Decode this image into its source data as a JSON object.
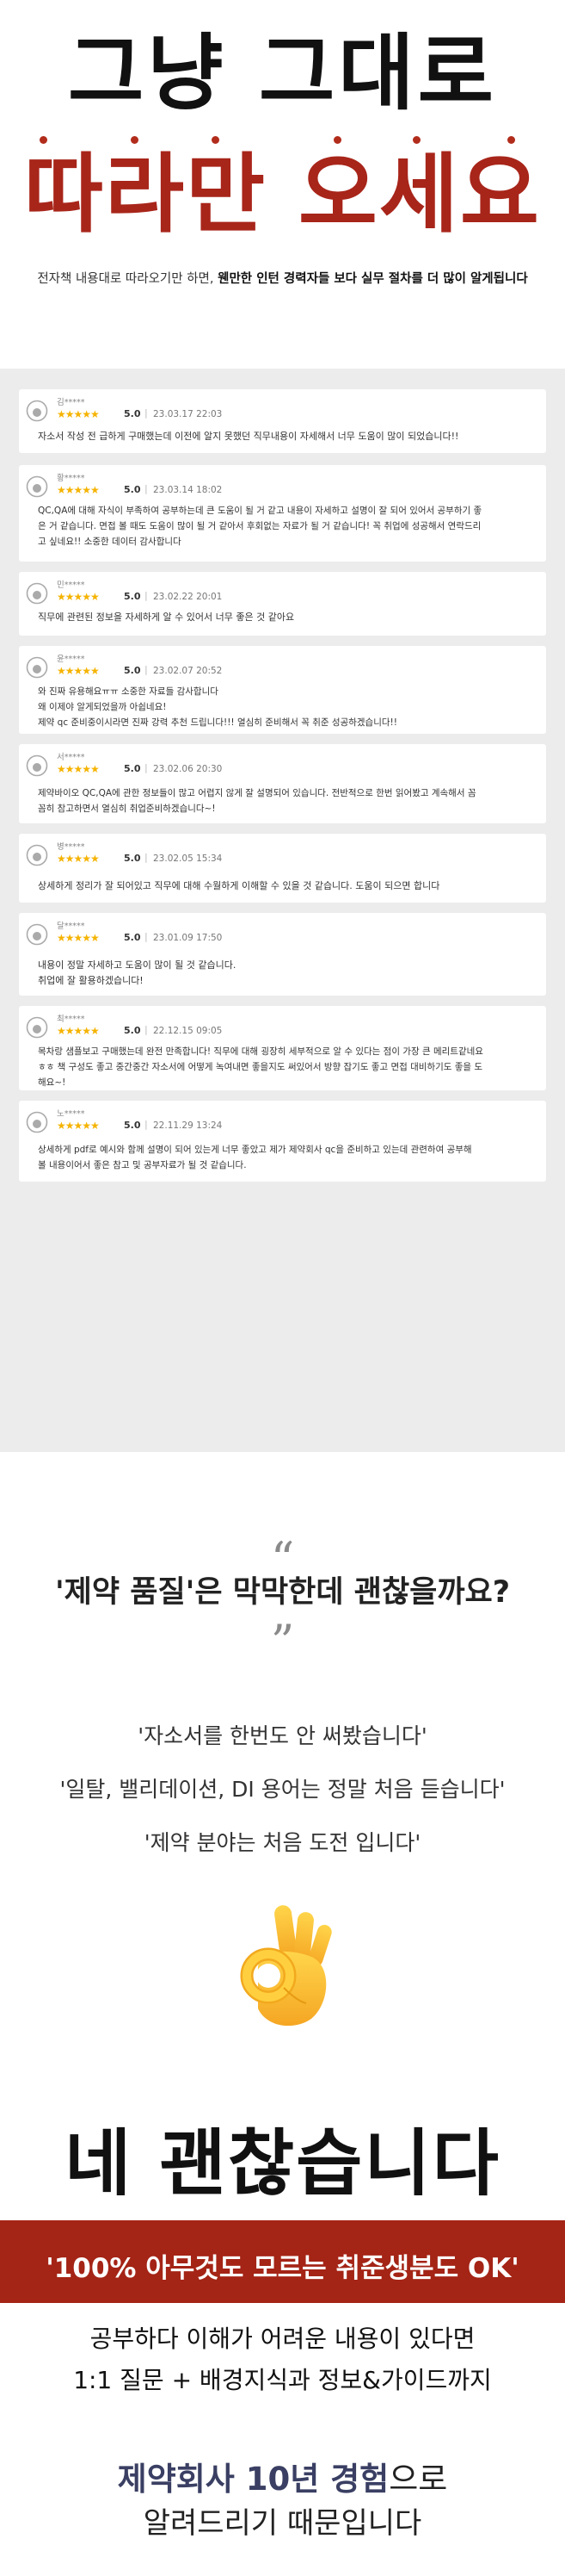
{
  "hero": {
    "line1": "그냥 그대로",
    "line2": "따라만 오세요",
    "subtitle_prefix": "전자책 내용대로 따라오기만 하면, ",
    "subtitle_bold": "웬만한 인턴 경력자들 보다 실무 절차를 더 많이 알게됩니다",
    "accent_color": "#a8251a"
  },
  "reviews": [
    {
      "user": "김*****",
      "stars": "★★★★★",
      "score": "5.0",
      "date": "23.03.17 22:03",
      "lines": [
        "자소서 작성 전 급하게 구매했는데 이전에 알지 못했던 직무내용이 자세해서 너무 도움이 많이 되었습니다!!"
      ]
    },
    {
      "user": "황*****",
      "stars": "★★★★★",
      "score": "5.0",
      "date": "23.03.14 18:02",
      "lines": [
        "QC,QA에 대해 자식이 부족하여 공부하는데 큰 도움이 될 거 같고 내용이 자세하고 설명이 잘 되어 있어서 공부하기 좋",
        "은 거 같습니다. 면접 볼 때도 도움이 많이 될 거 같아서 후회없는 자료가 될 거 같습니다! 꼭 취업에 성공해서 연락드리",
        "고 싶네요!! 소중한 데이터 감사합니다"
      ]
    },
    {
      "user": "민*****",
      "stars": "★★★★★",
      "score": "5.0",
      "date": "23.02.22 20:01",
      "lines": [
        "직무에 관련된 정보을 자세하게 알 수 있어서 너무 좋은 것 같아요"
      ]
    },
    {
      "user": "윤*****",
      "stars": "★★★★★",
      "score": "5.0",
      "date": "23.02.07 20:52",
      "lines": [
        "와 진짜 유용해요ㅠㅠ 소중한 자료들 감사합니다",
        "왜 이제야 알게되었을까 아쉽네요!",
        "제약 qc 준비중이시라면 진짜 강력 추천 드립니다!!! 열심히 준비해서 꼭 취준 성공하겠습니다!!"
      ]
    },
    {
      "user": "서*****",
      "stars": "★★★★★",
      "score": "5.0",
      "date": "23.02.06 20:30",
      "lines": [
        "제약바이오 QC,QA에 관한 정보들이 많고 어렵지 않게 잘 설명되어 있습니다. 전반적으로 한번 읽어봤고 계속해서 꼼",
        "꼼히 참고하면서 열심히 취업준비하겠습니다~!"
      ]
    },
    {
      "user": "병*****",
      "stars": "★★★★★",
      "score": "5.0",
      "date": "23.02.05 15:34",
      "lines": [
        "상세하게 정리가 잘 되어있고 직무에 대해 수월하게 이해할 수 있을 것 같습니다. 도움이 되으면 합니다"
      ]
    },
    {
      "user": "달*****",
      "stars": "★★★★★",
      "score": "5.0",
      "date": "23.01.09 17:50",
      "lines": [
        "내용이 정말 자세하고 도움이 많이 될 것 같습니다.",
        "취업에 잘 활용하겠습니다!"
      ]
    },
    {
      "user": "최*****",
      "stars": "★★★★★",
      "score": "5.0",
      "date": "22.12.15 09:05",
      "lines": [
        "목차랑 샘플보고 구매했는데 완전 만족합니다! 직무에 대해 굉장히 세부적으로 알 수 있다는 점이 가장 큰 메리트같네요",
        "ㅎㅎ 책 구성도 좋고 중간중간 자소서에 어떻게 녹여내면 좋을지도 써있어서 방향 잡기도 좋고 면접 대비하기도 좋을 도",
        "해요~!"
      ]
    },
    {
      "user": "노*****",
      "stars": "★★★★★",
      "score": "5.0",
      "date": "22.11.29 13:24",
      "lines": [
        "상세하게 pdf로 예시와 함께 설명이 되어 있는게 너무 좋았고 제가 제약회사 qc을 준비하고 있는데 관련하여 공부해",
        "볼 내용이어서 좋은 참고 및 공부자료가 될 것 같습니다."
      ]
    }
  ],
  "quote": {
    "open_mark": "“",
    "heading": "'제약 품질'은 막막한데 괜찮을까요?",
    "close_mark": "”",
    "concerns": [
      "'자소서를 한번도 안 써봤습니다'",
      "'일탈, 밸리데이션, DI 용어는 정말 처음 듣습니다'",
      "'제약 분야는 처음 도전 입니다'"
    ]
  },
  "icons": {
    "ok_hand": "ok-hand-icon",
    "avatar": "user-avatar-icon"
  },
  "answer": {
    "big": "네 괜찮습니다",
    "banner": "'100% 아무것도 모르는 취준생분도 OK'",
    "banner_color": "#a42416",
    "line1": "공부하다 이해가 어려운 내용이 있다면",
    "line2": "1:1 질문 +  배경지식과 정보&가이드까지",
    "closing_highlight": "제약회사 10년 경험",
    "closing_suffix": "으로",
    "closing2": "알려드리기 때문입니다"
  }
}
